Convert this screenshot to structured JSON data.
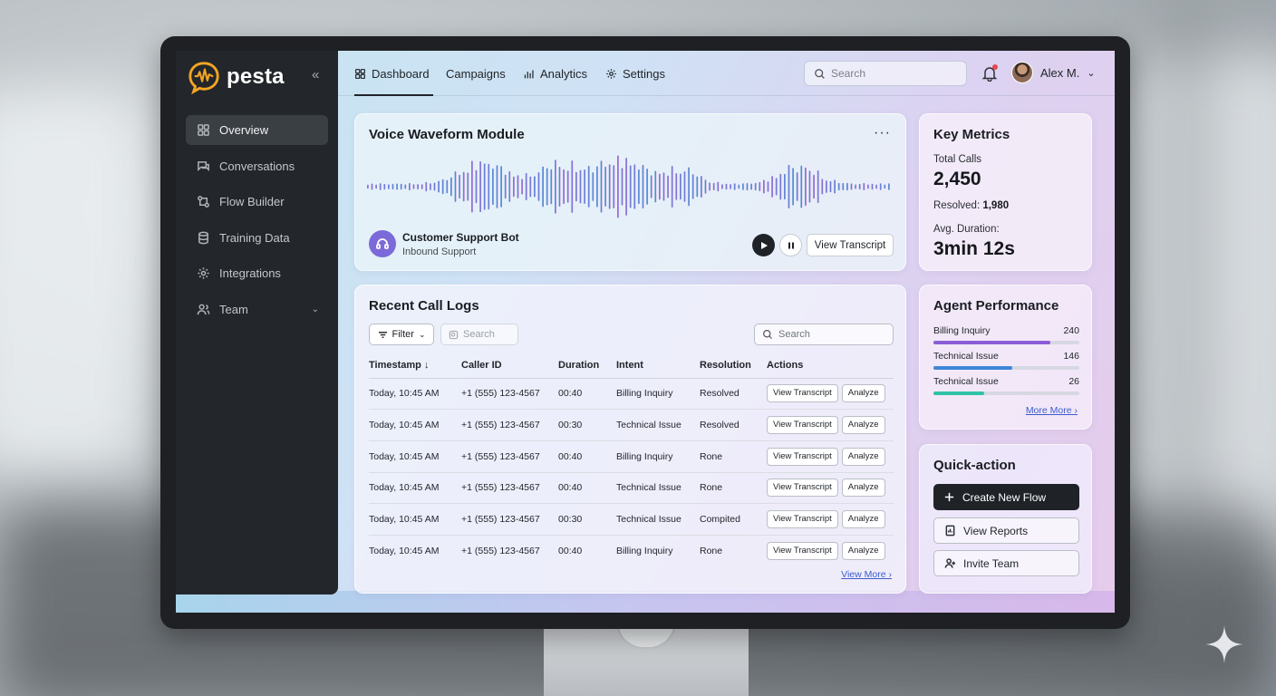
{
  "app": {
    "logo_text": "pesta",
    "brand_color": "#f5a623"
  },
  "sidebar": {
    "items": [
      {
        "label": "Overview",
        "icon": "grid-icon",
        "active": true
      },
      {
        "label": "Conversations",
        "icon": "chat-icon"
      },
      {
        "label": "Flow Builder",
        "icon": "flow-icon"
      },
      {
        "label": "Training Data",
        "icon": "database-icon"
      },
      {
        "label": "Integrations",
        "icon": "gear-icon"
      },
      {
        "label": "Team",
        "icon": "users-icon",
        "expandable": true
      }
    ]
  },
  "topbar": {
    "tabs": [
      {
        "label": "Dashboard",
        "icon": "grid-icon",
        "active": true
      },
      {
        "label": "Campaigns"
      },
      {
        "label": "Analytics",
        "icon": "bar-chart-icon"
      },
      {
        "label": "Settings",
        "icon": "gear-icon"
      }
    ],
    "search_placeholder": "Search",
    "user_name": "Alex M.",
    "notification_dot": true
  },
  "voice_module": {
    "title": "Voice Waveform Module",
    "bot_name": "Customer Support Bot",
    "bot_subtitle": "Inbound Support",
    "view_transcript_label": "View Transcript",
    "gradient_colors": [
      "#5aa9d6",
      "#6b7fd6",
      "#9b6ad8",
      "#d07ad6"
    ]
  },
  "key_metrics": {
    "title": "Key Metrics",
    "total_calls_label": "Total Calls",
    "total_calls_value": "2,450",
    "resolved_label": "Resolved:",
    "resolved_value": "1,980",
    "avg_duration_label": "Avg. Duration:",
    "avg_duration_value": "3min 12s"
  },
  "call_logs": {
    "title": "Recent Call Logs",
    "filter_label": "Filter",
    "search_small_placeholder": "Search",
    "search_placeholder": "Search",
    "columns": [
      "Timestamp",
      "Caller ID",
      "Duration",
      "Intent",
      "Resolution",
      "Actions"
    ],
    "rows": [
      {
        "timestamp": "Today, 10:45 AM",
        "caller": "+1 (555) 123-4567",
        "duration": "00:40",
        "intent": "Billing Inquiry",
        "resolution": "Resolved"
      },
      {
        "timestamp": "Today, 10:45 AM",
        "caller": "+1 (555) 123-4567",
        "duration": "00:30",
        "intent": "Technical Issue",
        "resolution": "Resolved"
      },
      {
        "timestamp": "Today, 10:45 AM",
        "caller": "+1 (555) 123-4567",
        "duration": "00:40",
        "intent": "Billing Inquiry",
        "resolution": "Rone"
      },
      {
        "timestamp": "Today, 10:45 AM",
        "caller": "+1 (555) 123-4567",
        "duration": "00:40",
        "intent": "Technical Issue",
        "resolution": "Rone"
      },
      {
        "timestamp": "Today, 10:45 AM",
        "caller": "+1 (555) 123-4567",
        "duration": "00:30",
        "intent": "Technical Issue",
        "resolution": "Compited"
      },
      {
        "timestamp": "Today, 10:45 AM",
        "caller": "+1 (555) 123-4567",
        "duration": "00:40",
        "intent": "Billing Inquiry",
        "resolution": "Rone"
      }
    ],
    "view_transcript_label": "View Transcript",
    "analyze_label": "Analyze",
    "view_more_label": "View More"
  },
  "agent_performance": {
    "title": "Agent Performance",
    "items": [
      {
        "label": "Billing Inquiry",
        "value": "240",
        "fill": 0.8,
        "color": "#8a5cd6"
      },
      {
        "label": "Technical Issue",
        "value": "146",
        "fill": 0.54,
        "color": "#3f86d8"
      },
      {
        "label": "Technical Issue",
        "value": "26",
        "fill": 0.35,
        "color": "#2fc2a8"
      }
    ],
    "more_label": "More More"
  },
  "quick_action": {
    "title": "Quick-action",
    "buttons": [
      {
        "label": "Create New Flow",
        "icon": "plus-icon",
        "style": "dark"
      },
      {
        "label": "View Reports",
        "icon": "report-icon",
        "style": "light"
      },
      {
        "label": "Invite Team",
        "icon": "invite-icon",
        "style": "light"
      }
    ]
  }
}
